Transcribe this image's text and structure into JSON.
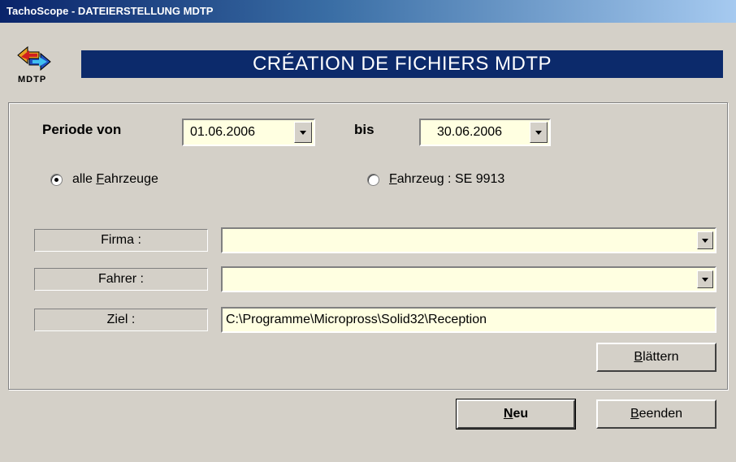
{
  "window": {
    "title": "TachoScope - DATEIERSTELLUNG MDTP"
  },
  "header": {
    "logo_text": "MDTP",
    "banner": "CRÉATION DE FICHIERS MDTP"
  },
  "period": {
    "from_label": "Periode von",
    "from_value": "01.06.2006",
    "to_label": "bis",
    "to_value": "30.06.2006"
  },
  "vehicles": {
    "all_prefix": "alle ",
    "all_mnemonic": "F",
    "all_rest": "ahrzeuge",
    "single_mnemonic": "F",
    "single_rest": "ahrzeug : SE 9913",
    "selected": "all"
  },
  "fields": {
    "firma_label": "Firma :",
    "firma_value": "",
    "fahrer_label": "Fahrer :",
    "fahrer_value": "",
    "ziel_label": "Ziel :",
    "ziel_value": "C:\\Programme\\Micropross\\Solid32\\Reception"
  },
  "buttons": {
    "browse_mnemonic": "B",
    "browse_rest": "lättern",
    "new_mnemonic": "N",
    "new_rest": "eu",
    "quit_mnemonic": "B",
    "quit_rest": "eenden"
  },
  "colors": {
    "banner_bg": "#0c2a6b",
    "field_bg": "#ffffe1",
    "window_bg": "#d4d0c8"
  }
}
